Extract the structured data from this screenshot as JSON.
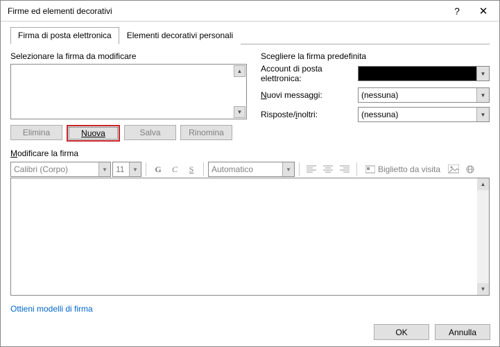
{
  "window": {
    "title": "Firme ed elementi decorativi"
  },
  "tabs": {
    "email": "Firma di posta elettronica",
    "stationery": "Elementi decorativi personali"
  },
  "left": {
    "select_label": "Selezionare la firma da modificare",
    "btn_delete": "Elimina",
    "btn_new": "Nuova",
    "btn_save": "Salva",
    "btn_rename": "Rinomina"
  },
  "right": {
    "group_label": "Scegliere la firma predefinita",
    "account_label": "Account di posta elettronica:",
    "new_label_pre": "N",
    "new_label_post": "uovi messaggi:",
    "new_value": "(nessuna)",
    "reply_label_pre": "Risposte/",
    "reply_label_und": "i",
    "reply_label_post": "noltri:",
    "reply_value": "(nessuna)"
  },
  "edit": {
    "label_pre": "",
    "label": "Modificare la firma",
    "font": "Calibri (Corpo)",
    "size": "11",
    "bold": "G",
    "italic": "C",
    "underline": "S",
    "color": "Automatico",
    "bizcard": "Biglietto da visita"
  },
  "link": {
    "text": "Ottieni modelli di firma"
  },
  "footer": {
    "ok": "OK",
    "cancel": "Annulla"
  }
}
